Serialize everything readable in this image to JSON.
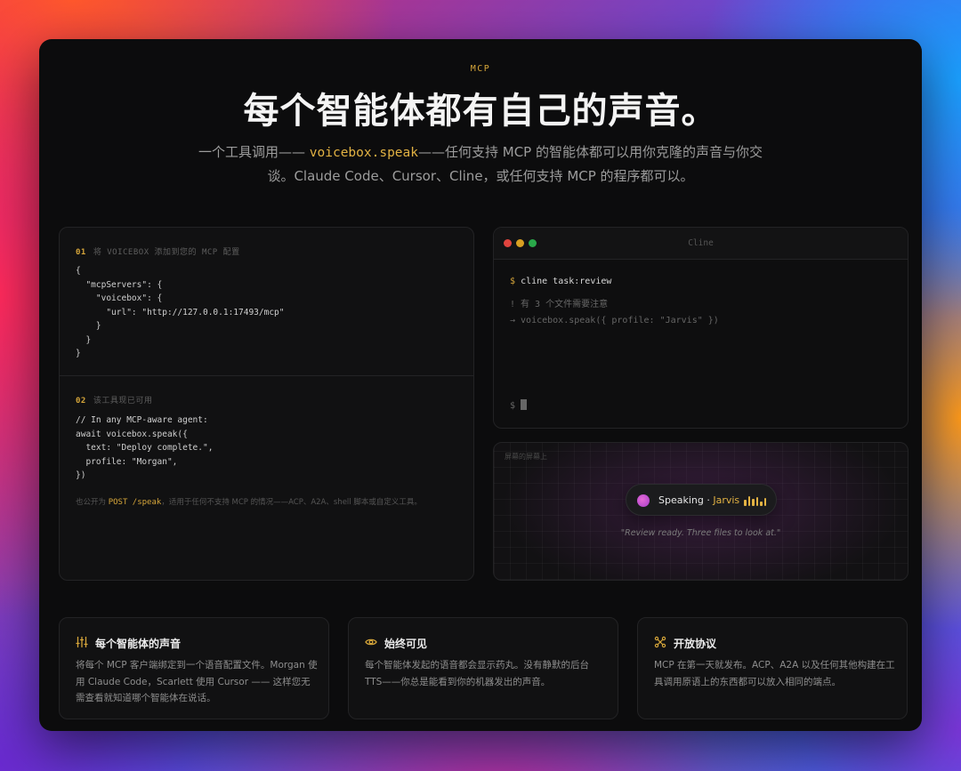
{
  "header": {
    "eyebrow": "MCP",
    "headline": "每个智能体都有自己的声音。",
    "sub_a": "一个工具调用—— ",
    "sub_code": "voicebox.speak",
    "sub_b": "——任何支持 MCP 的智能体都可以用你克隆的声音与你交谈。Claude Code、Cursor、Cline，或任何支持 MCP 的程序都可以。"
  },
  "config": {
    "step1_num": "01",
    "step1_label": "将 VOICEBOX 添加到您的 MCP 配置",
    "step1_code": "{\n  \"mcpServers\": {\n    \"voicebox\": {\n      \"url\": \"http://127.0.0.1:17493/mcp\"\n    }\n  }\n}",
    "step2_num": "02",
    "step2_label": "该工具现已可用",
    "step2_code": "// In any MCP-aware agent:\nawait voicebox.speak({\n  text: \"Deploy complete.\",\n  profile: \"Morgan\",\n})",
    "note_a": "也公开为 ",
    "note_code": "POST /speak",
    "note_b": "，适用于任何不支持 MCP 的情况——ACP、A2A、shell 脚本或自定义工具。"
  },
  "terminal": {
    "title": "Cline",
    "prompt": "$",
    "command": "cline task:review",
    "line2": "! 有 3 个文件需要注意",
    "line3": "→ voicebox.speak({ profile: \"Jarvis\" })",
    "prompt_end": "$"
  },
  "desk": {
    "label": "屏幕的屏幕上",
    "speaking": "Speaking · ",
    "speaker": "Jarvis",
    "level_bars": [
      0.55,
      0.95,
      0.65,
      0.85,
      0.4,
      0.75
    ],
    "quote": "\"Review ready. Three files to look at.\""
  },
  "features": [
    {
      "icon": "sliders-icon",
      "title": "每个智能体的声音",
      "body": "将每个 MCP 客户端绑定到一个语音配置文件。Morgan 使用 Claude Code，Scarlett 使用 Cursor —— 这样您无需查看就知道哪个智能体在说话。"
    },
    {
      "icon": "eye-icon",
      "title": "始终可见",
      "body": "每个智能体发起的语音都会显示药丸。没有静默的后台 TTS——你总是能看到你的机器发出的声音。"
    },
    {
      "icon": "network-icon",
      "title": "开放协议",
      "body": "MCP 在第一天就发布。ACP、A2A 以及任何其他构建在工具调用原语上的东西都可以放入相同的端点。"
    }
  ],
  "colors": {
    "accent": "#d5a53a",
    "window_bg": "#0c0c0d",
    "dot_red": "#e0443e",
    "dot_yellow": "#d8a022",
    "dot_green": "#2aa94a"
  }
}
